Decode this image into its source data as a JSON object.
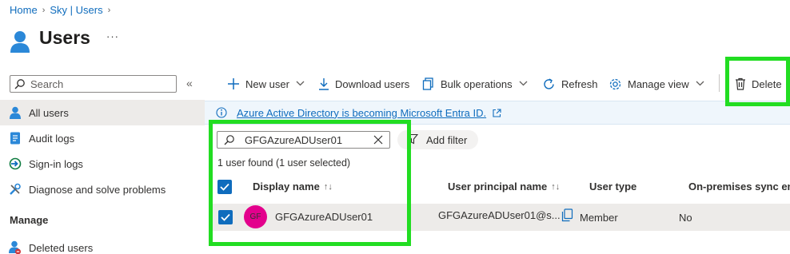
{
  "breadcrumb": {
    "home": "Home",
    "sky_users": "Sky | Users"
  },
  "page": {
    "title": "Users",
    "more": "···"
  },
  "left_nav": {
    "search_placeholder": "Search",
    "collapse": "«",
    "items": [
      {
        "label": "All users",
        "icon": "user-icon",
        "active": true
      },
      {
        "label": "Audit logs",
        "icon": "audit-log-icon"
      },
      {
        "label": "Sign-in logs",
        "icon": "sign-in-icon"
      },
      {
        "label": "Diagnose and solve problems",
        "icon": "diagnose-icon"
      }
    ],
    "section_manage": "Manage",
    "manage_items": [
      {
        "label": "Deleted users",
        "icon": "deleted-users-icon"
      }
    ]
  },
  "toolbar": {
    "new_user": "New user",
    "download_users": "Download users",
    "bulk_operations": "Bulk operations",
    "refresh": "Refresh",
    "manage_view": "Manage view",
    "delete": "Delete"
  },
  "banner": {
    "message": "Azure Active Directory is becoming Microsoft Entra ID."
  },
  "filter": {
    "value": "GFGAzureADUser01",
    "add_filter": "Add filter"
  },
  "results": {
    "count": "1 user found (1 user selected)"
  },
  "table": {
    "columns": [
      "Display name",
      "User principal name",
      "User type",
      "On-premises sync en."
    ],
    "sort_glyph": "↑↓",
    "rows": [
      {
        "initials": "GF",
        "display_name": "GFGAzureADUser01",
        "upn": "GFGAzureADUser01@s...",
        "user_type": "Member",
        "sync": "No",
        "selected": true
      }
    ]
  },
  "colors": {
    "accent": "#0f6cbd",
    "avatar": "#e3008c",
    "highlight": "#22dd22"
  }
}
